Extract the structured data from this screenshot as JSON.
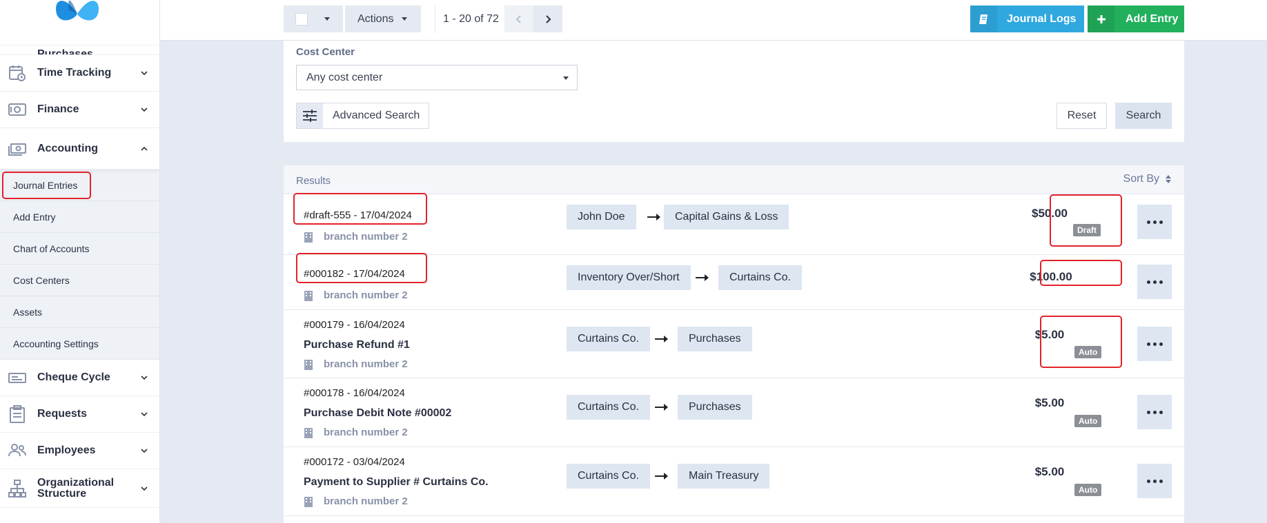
{
  "sidebar": {
    "partial_label": "Purchases",
    "items": [
      {
        "label": "Time Tracking",
        "icon": "calendar-clock-icon"
      },
      {
        "label": "Finance",
        "icon": "safe-icon"
      },
      {
        "label": "Accounting",
        "icon": "money-icon"
      }
    ],
    "accounting_sub": [
      "Journal Entries",
      "Add Entry",
      "Chart of Accounts",
      "Cost Centers",
      "Assets",
      "Accounting Settings"
    ],
    "items_after": [
      {
        "label": "Cheque Cycle",
        "icon": "cheque-icon"
      },
      {
        "label": "Requests",
        "icon": "clipboard-icon"
      },
      {
        "label": "Employees",
        "icon": "users-icon"
      },
      {
        "label_line1": "Organizational",
        "label_line2": "Structure",
        "icon": "org-chart-icon"
      }
    ]
  },
  "toolbar": {
    "actions_label": "Actions",
    "pager_text": "1 - 20 of 72",
    "journal_logs_label": "Journal Logs",
    "add_entry_label": "Add Entry"
  },
  "search": {
    "cost_center_label": "Cost Center",
    "cost_center_value": "Any cost center",
    "advanced_search_label": "Advanced Search",
    "reset_label": "Reset",
    "search_label": "Search"
  },
  "results": {
    "label": "Results",
    "sort_by_label": "Sort By",
    "rows": [
      {
        "id": "#draft-555 - 17/04/2024",
        "desc": "",
        "branch": "branch number 2",
        "from": "John Doe",
        "to": "Capital Gains & Loss",
        "amount": "$50.00",
        "badge": "Draft"
      },
      {
        "id": "#000182 - 17/04/2024",
        "desc": "",
        "branch": "branch number 2",
        "from": "Inventory Over/Short",
        "to": "Curtains Co.",
        "amount": "$100.00",
        "badge": ""
      },
      {
        "id": "#000179 - 16/04/2024",
        "desc": "Purchase Refund #1",
        "branch": "branch number 2",
        "from": "Curtains Co.",
        "to": "Purchases",
        "amount": "$5.00",
        "badge": "Auto"
      },
      {
        "id": "#000178 - 16/04/2024",
        "desc": "Purchase Debit Note #00002",
        "branch": "branch number 2",
        "from": "Curtains Co.",
        "to": "Purchases",
        "amount": "$5.00",
        "badge": "Auto"
      },
      {
        "id": "#000172 - 03/04/2024",
        "desc": "Payment to Supplier # Curtains Co.",
        "branch": "branch number 2",
        "from": "Curtains Co.",
        "to": "Main Treasury",
        "amount": "$5.00",
        "badge": "Auto"
      }
    ]
  },
  "colors": {
    "journal_logs": "#2fa8df",
    "add_entry": "#22b05d",
    "highlight": "#e2212b",
    "badge": "#8b8f96"
  }
}
